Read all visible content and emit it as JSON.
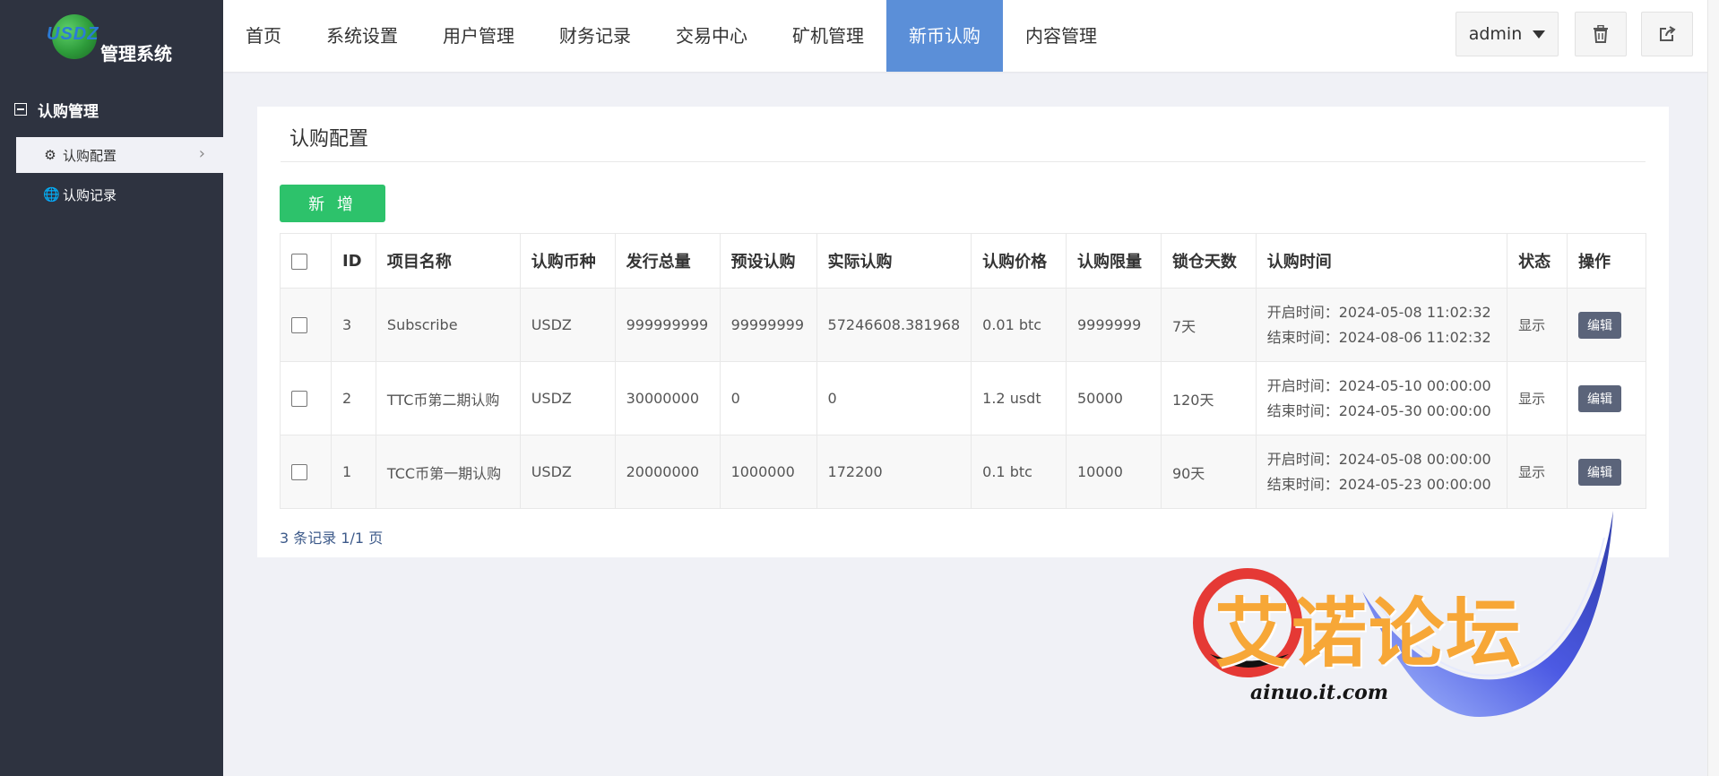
{
  "logo": {
    "brand": "USDZ",
    "system": "管理系统"
  },
  "nav": {
    "items": [
      "首页",
      "系统设置",
      "用户管理",
      "财务记录",
      "交易中心",
      "矿机管理",
      "新币认购",
      "内容管理"
    ],
    "active": "新币认购"
  },
  "user": {
    "name": "admin"
  },
  "sidebar": {
    "group": "认购管理",
    "items": [
      {
        "label": "认购配置",
        "icon": "gear-icon",
        "active": true
      },
      {
        "label": "认购记录",
        "icon": "globe-icon",
        "active": false
      }
    ]
  },
  "panel": {
    "title": "认购配置",
    "add_label": "新 增"
  },
  "table": {
    "columns": [
      "ID",
      "项目名称",
      "认购币种",
      "发行总量",
      "预设认购",
      "实际认购",
      "认购价格",
      "认购限量",
      "锁仓天数",
      "认购时间",
      "状态",
      "操作"
    ],
    "rows": [
      {
        "id": "3",
        "name": "Subscribe",
        "coin": "USDZ",
        "total": "999999999",
        "preset": "99999999",
        "actual": "57246608.381968",
        "price": "0.01 btc",
        "limit": "9999999",
        "lock_days": "7天",
        "start": "开启时间：2024-05-08 11:02:32",
        "end": "结束时间：2024-08-06 11:02:32",
        "status": "显示",
        "action": "编辑"
      },
      {
        "id": "2",
        "name": "TTC币第二期认购",
        "coin": "USDZ",
        "total": "30000000",
        "preset": "0",
        "actual": "0",
        "price": "1.2 usdt",
        "limit": "50000",
        "lock_days": "120天",
        "start": "开启时间：2024-05-10 00:00:00",
        "end": "结束时间：2024-05-30 00:00:00",
        "status": "显示",
        "action": "编辑"
      },
      {
        "id": "1",
        "name": "TCC币第一期认购",
        "coin": "USDZ",
        "total": "20000000",
        "preset": "1000000",
        "actual": "172200",
        "price": "0.1 btc",
        "limit": "10000",
        "lock_days": "90天",
        "start": "开启时间：2024-05-08 00:00:00",
        "end": "结束时间：2024-05-23 00:00:00",
        "status": "显示",
        "action": "编辑"
      }
    ]
  },
  "pagination": {
    "summary": "3 条记录 1/1 页"
  },
  "watermark": {
    "title": "艾诺论坛",
    "url": "ainuo.it.com"
  },
  "colors": {
    "sidebar_bg": "#2e3340",
    "nav_active": "#5b8fd8",
    "add_button": "#2dc26b",
    "edit_button": "#5b647a",
    "watermark": "#f7a737"
  }
}
